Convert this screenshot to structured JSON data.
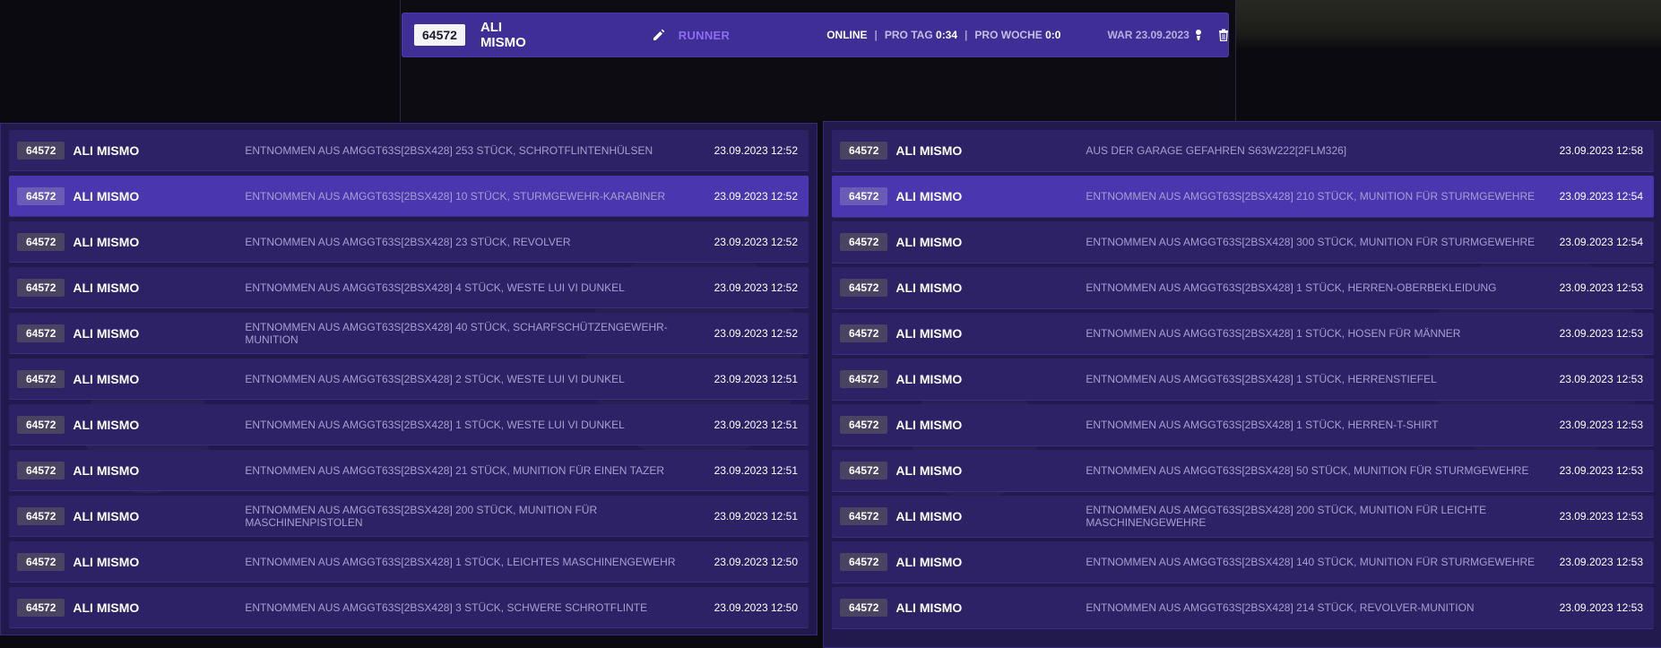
{
  "header": {
    "id": "64572",
    "name": "ALI MISMO",
    "role": "RUNNER",
    "status": "ONLINE",
    "pro_tag_label": "PRO TAG",
    "pro_tag_value": "0:34",
    "pro_woche_label": "PRO WOCHE",
    "pro_woche_value": "0:0",
    "war": "WAR 23.09.2023",
    "status_color": "#8cd94a",
    "accent_color": "#3e2e96",
    "role_color": "#8d6df0"
  },
  "left_log": [
    {
      "id": "64572",
      "name": "ALI MISMO",
      "text": "ENTNOMMEN AUS AMGGT63S[2BSX428] 253 STÜCK, SCHROTFLINTENHÜLSEN",
      "date": "23.09.2023 12:52"
    },
    {
      "id": "64572",
      "name": "ALI MISMO",
      "text": "ENTNOMMEN AUS AMGGT63S[2BSX428] 10 STÜCK, STURMGEWEHR-KARABINER",
      "date": "23.09.2023 12:52"
    },
    {
      "id": "64572",
      "name": "ALI MISMO",
      "text": "ENTNOMMEN AUS AMGGT63S[2BSX428] 23 STÜCK, REVOLVER",
      "date": "23.09.2023 12:52"
    },
    {
      "id": "64572",
      "name": "ALI MISMO",
      "text": "ENTNOMMEN AUS AMGGT63S[2BSX428] 4 STÜCK, WESTE LUI VI DUNKEL",
      "date": "23.09.2023 12:52"
    },
    {
      "id": "64572",
      "name": "ALI MISMO",
      "text": "ENTNOMMEN AUS AMGGT63S[2BSX428] 40 STÜCK, SCHARFSCHÜTZENGEWEHR-MUNITION",
      "date": "23.09.2023 12:52"
    },
    {
      "id": "64572",
      "name": "ALI MISMO",
      "text": "ENTNOMMEN AUS AMGGT63S[2BSX428] 2 STÜCK, WESTE LUI VI DUNKEL",
      "date": "23.09.2023 12:51"
    },
    {
      "id": "64572",
      "name": "ALI MISMO",
      "text": "ENTNOMMEN AUS AMGGT63S[2BSX428] 1 STÜCK, WESTE LUI VI DUNKEL",
      "date": "23.09.2023 12:51"
    },
    {
      "id": "64572",
      "name": "ALI MISMO",
      "text": "ENTNOMMEN AUS AMGGT63S[2BSX428] 21 STÜCK, MUNITION FÜR EINEN TAZER",
      "date": "23.09.2023 12:51"
    },
    {
      "id": "64572",
      "name": "ALI MISMO",
      "text": "ENTNOMMEN AUS AMGGT63S[2BSX428] 200 STÜCK, MUNITION FÜR MASCHINENPISTOLEN",
      "date": "23.09.2023 12:51"
    },
    {
      "id": "64572",
      "name": "ALI MISMO",
      "text": "ENTNOMMEN AUS AMGGT63S[2BSX428] 1 STÜCK, LEICHTES MASCHINENGEWEHR",
      "date": "23.09.2023 12:50"
    },
    {
      "id": "64572",
      "name": "ALI MISMO",
      "text": "ENTNOMMEN AUS AMGGT63S[2BSX428] 3 STÜCK, SCHWERE SCHROTFLINTE",
      "date": "23.09.2023 12:50"
    }
  ],
  "right_log": [
    {
      "id": "64572",
      "name": "ALI MISMO",
      "text": "AUS DER GARAGE GEFAHREN S63W222[2FLM326]",
      "date": "23.09.2023 12:58"
    },
    {
      "id": "64572",
      "name": "ALI MISMO",
      "text": "ENTNOMMEN AUS AMGGT63S[2BSX428] 210 STÜCK, MUNITION FÜR STURMGEWEHRE",
      "date": "23.09.2023 12:54"
    },
    {
      "id": "64572",
      "name": "ALI MISMO",
      "text": "ENTNOMMEN AUS AMGGT63S[2BSX428] 300 STÜCK, MUNITION FÜR STURMGEWEHRE",
      "date": "23.09.2023 12:54"
    },
    {
      "id": "64572",
      "name": "ALI MISMO",
      "text": "ENTNOMMEN AUS AMGGT63S[2BSX428] 1 STÜCK, HERREN-OBERBEKLEIDUNG",
      "date": "23.09.2023 12:53"
    },
    {
      "id": "64572",
      "name": "ALI MISMO",
      "text": "ENTNOMMEN AUS AMGGT63S[2BSX428] 1 STÜCK, HOSEN FÜR MÄNNER",
      "date": "23.09.2023 12:53"
    },
    {
      "id": "64572",
      "name": "ALI MISMO",
      "text": "ENTNOMMEN AUS AMGGT63S[2BSX428] 1 STÜCK, HERRENSTIEFEL",
      "date": "23.09.2023 12:53"
    },
    {
      "id": "64572",
      "name": "ALI MISMO",
      "text": "ENTNOMMEN AUS AMGGT63S[2BSX428] 1 STÜCK, HERREN-T-SHIRT",
      "date": "23.09.2023 12:53"
    },
    {
      "id": "64572",
      "name": "ALI MISMO",
      "text": "ENTNOMMEN AUS AMGGT63S[2BSX428] 50 STÜCK, MUNITION FÜR STURMGEWEHRE",
      "date": "23.09.2023 12:53"
    },
    {
      "id": "64572",
      "name": "ALI MISMO",
      "text": "ENTNOMMEN AUS AMGGT63S[2BSX428] 200 STÜCK, MUNITION FÜR LEICHTE MASCHINENGEWEHRE",
      "date": "23.09.2023 12:53"
    },
    {
      "id": "64572",
      "name": "ALI MISMO",
      "text": "ENTNOMMEN AUS AMGGT63S[2BSX428] 140 STÜCK, MUNITION FÜR STURMGEWEHRE",
      "date": "23.09.2023 12:53"
    },
    {
      "id": "64572",
      "name": "ALI MISMO",
      "text": "ENTNOMMEN AUS AMGGT63S[2BSX428] 214 STÜCK, REVOLVER-MUNITION",
      "date": "23.09.2023 12:53"
    }
  ],
  "selected": {
    "left_index": 1,
    "right_index": 1
  },
  "icons": {
    "edit": "pencil-icon",
    "player": "person-icon",
    "delete": "trash-icon"
  }
}
